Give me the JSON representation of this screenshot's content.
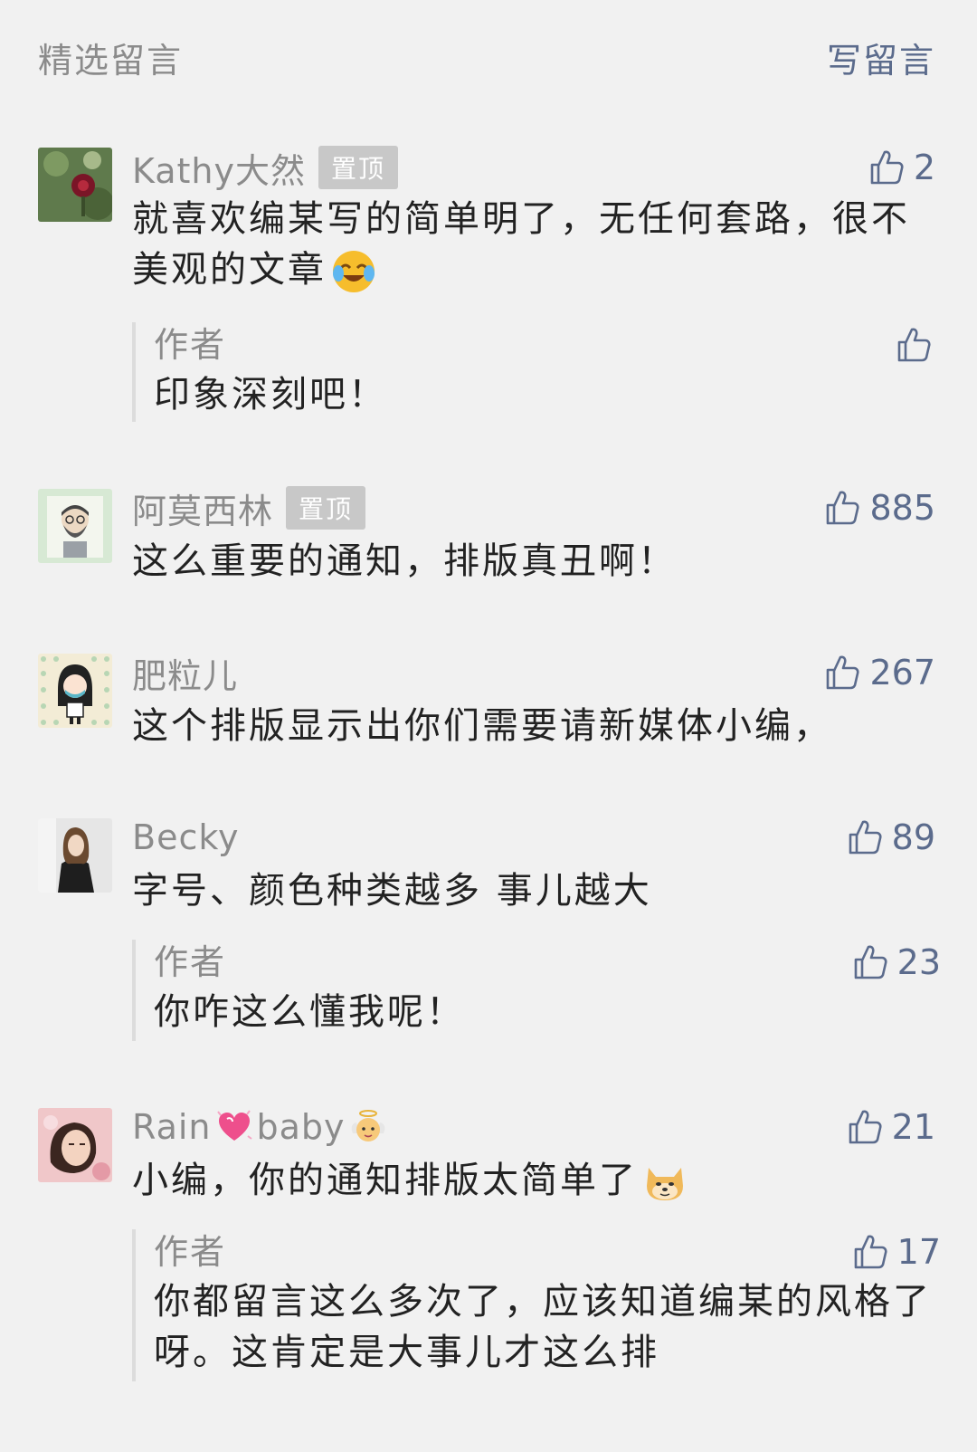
{
  "header": {
    "title": "精选留言",
    "write_label": "写留言"
  },
  "comments": [
    {
      "nickname": "Kathy大然",
      "pinned_label": "置顶",
      "likes": "2",
      "content": "就喜欢编某写的简单明了，无任何套路，很不美观的文章",
      "reply": {
        "author": "作者",
        "likes": "",
        "content": "印象深刻吧！"
      }
    },
    {
      "nickname": "阿莫西林",
      "pinned_label": "置顶",
      "likes": "885",
      "content": "这么重要的通知，排版真丑啊！"
    },
    {
      "nickname": "肥粒儿",
      "likes": "267",
      "content": "这个排版显示出你们需要请新媒体小编，"
    },
    {
      "nickname": "Becky",
      "likes": "89",
      "content": "字号、颜色种类越多 事儿越大",
      "reply": {
        "author": "作者",
        "likes": "23",
        "content": "你咋这么懂我呢！"
      }
    },
    {
      "nickname_part1": "Rain",
      "nickname_part2": "baby",
      "likes": "21",
      "content": "小编，你的通知排版太简单了",
      "reply": {
        "author": "作者",
        "likes": "17",
        "content": "你都留言这么多次了，应该知道编某的风格了呀。这肯定是大事儿才这么排"
      }
    }
  ],
  "icons": {
    "like": "thumbs-up-icon",
    "emoji_1": "laughing-crying-emoji",
    "emoji_heart": "sparkling-heart-emoji",
    "emoji_angel": "baby-angel-emoji",
    "emoji_doge": "doge-emoji"
  },
  "colors": {
    "background": "#f1f1f1",
    "link": "#5b6b8c",
    "muted": "#8b8b8b",
    "text": "#222222",
    "badge": "#c8c8c8"
  }
}
